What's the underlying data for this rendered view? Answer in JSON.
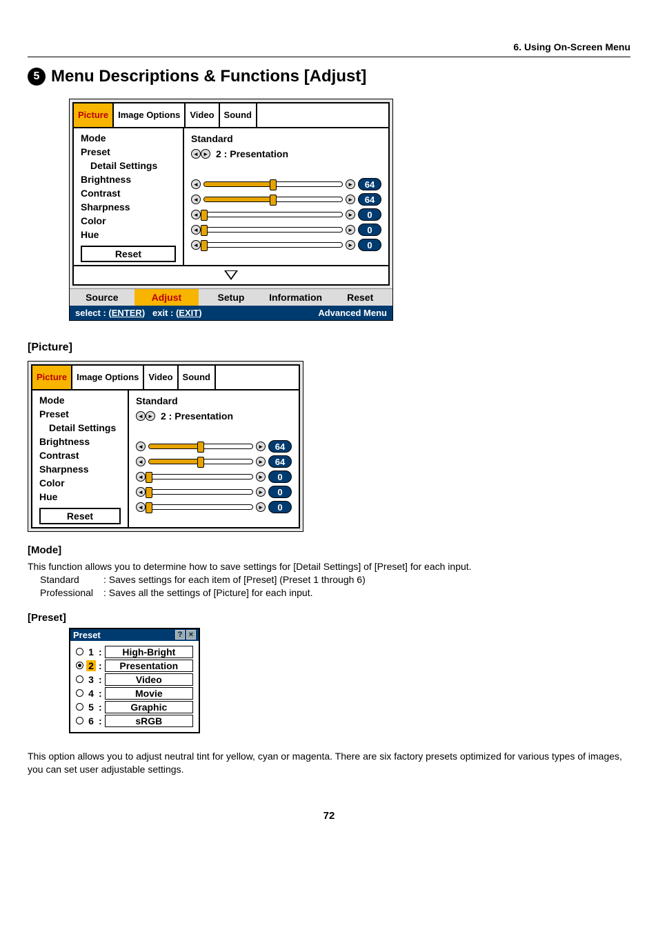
{
  "chapter_header": "6. Using On-Screen Menu",
  "main_heading_num": "5",
  "main_heading_text": "Menu Descriptions & Functions [Adjust]",
  "page_number": "72",
  "osd1": {
    "tabs": [
      "Picture",
      "Image Options",
      "Video",
      "Sound"
    ],
    "active_tab_index": 0,
    "left_items": [
      "Mode",
      "Preset",
      "Detail Settings",
      "Brightness",
      "Contrast",
      "Sharpness",
      "Color",
      "Hue"
    ],
    "reset_label": "Reset",
    "mode_value": "Standard",
    "preset_value": "2 : Presentation",
    "sliders": [
      {
        "label": "Brightness",
        "value": "64",
        "pct": 50
      },
      {
        "label": "Contrast",
        "value": "64",
        "pct": 50
      },
      {
        "label": "Sharpness",
        "value": "0",
        "pct": 0
      },
      {
        "label": "Color",
        "value": "0",
        "pct": 0
      },
      {
        "label": "Hue",
        "value": "0",
        "pct": 0
      }
    ],
    "bottom_tabs": [
      "Source",
      "Adjust",
      "Setup",
      "Information",
      "Reset"
    ],
    "bottom_active_index": 1,
    "hint_select_label": "select :",
    "hint_select_btn": "ENTER",
    "hint_exit_label": "exit :",
    "hint_exit_btn": "EXIT",
    "hint_right": "Advanced Menu"
  },
  "picture_heading": "[Picture]",
  "osd2": {
    "tabs": [
      "Picture",
      "Image Options",
      "Video",
      "Sound"
    ],
    "active_tab_index": 0,
    "left_items": [
      "Mode",
      "Preset",
      "Detail Settings",
      "Brightness",
      "Contrast",
      "Sharpness",
      "Color",
      "Hue"
    ],
    "reset_label": "Reset",
    "mode_value": "Standard",
    "preset_value": "2 : Presentation",
    "sliders": [
      {
        "label": "Brightness",
        "value": "64",
        "pct": 50
      },
      {
        "label": "Contrast",
        "value": "64",
        "pct": 50
      },
      {
        "label": "Sharpness",
        "value": "0",
        "pct": 0
      },
      {
        "label": "Color",
        "value": "0",
        "pct": 0
      },
      {
        "label": "Hue",
        "value": "0",
        "pct": 0
      }
    ]
  },
  "mode_heading": "[Mode]",
  "mode_intro": "This function allows you to determine how to save settings for [Detail Settings] of [Preset] for each input.",
  "mode_rows": [
    {
      "label": "Standard",
      "desc": ": Saves settings for each item of [Preset] (Preset 1 through 6)"
    },
    {
      "label": "Professional",
      "desc": ": Saves all the settings of [Picture] for each input."
    }
  ],
  "preset_heading": "[Preset]",
  "preset_dialog": {
    "title": "Preset",
    "items": [
      {
        "num": "1",
        "label": "High-Bright",
        "checked": false,
        "hl": false
      },
      {
        "num": "2",
        "label": "Presentation",
        "checked": true,
        "hl": true
      },
      {
        "num": "3",
        "label": "Video",
        "checked": false,
        "hl": false
      },
      {
        "num": "4",
        "label": "Movie",
        "checked": false,
        "hl": false
      },
      {
        "num": "5",
        "label": "Graphic",
        "checked": false,
        "hl": false
      },
      {
        "num": "6",
        "label": "sRGB",
        "checked": false,
        "hl": false
      }
    ]
  },
  "preset_body": "This option allows you to adjust neutral tint for yellow, cyan or magenta. There are six factory presets optimized for various types of images, you can set user adjustable settings."
}
